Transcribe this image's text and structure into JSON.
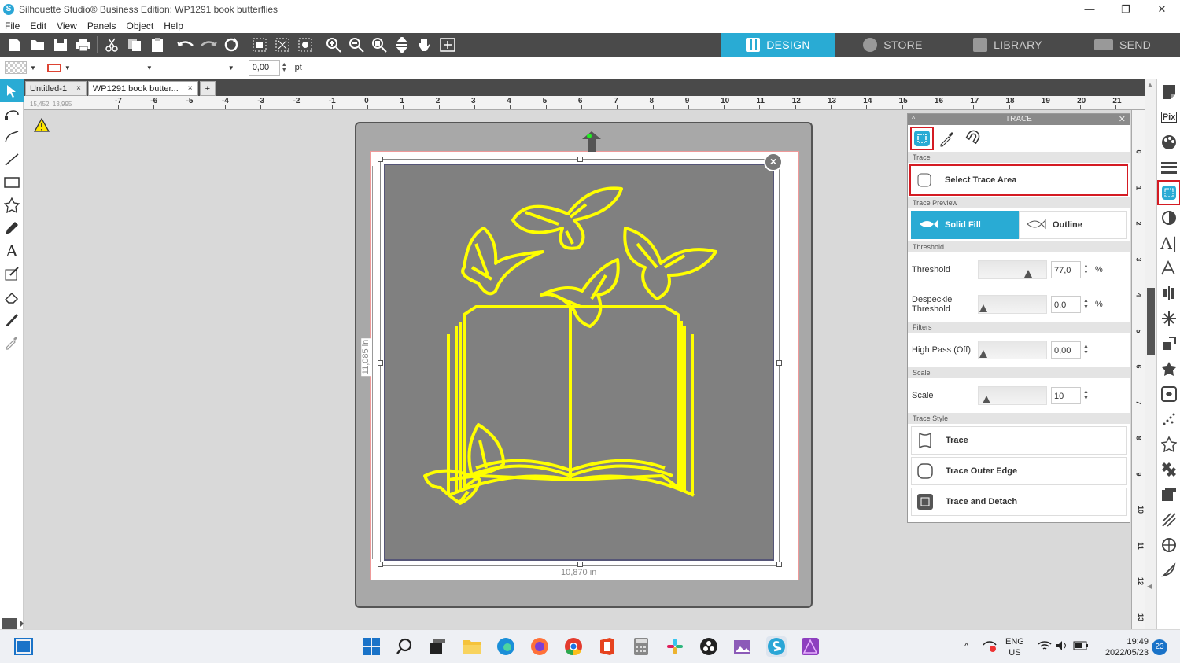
{
  "window": {
    "title": "Silhouette Studio® Business Edition: WP1291 book butterflies",
    "min_glyph": "—",
    "max_glyph": "❐",
    "close_glyph": "✕"
  },
  "menu": [
    "File",
    "Edit",
    "View",
    "Panels",
    "Object",
    "Help"
  ],
  "mode_tabs": [
    {
      "label": "DESIGN",
      "icon": "grid-icon",
      "active": true
    },
    {
      "label": "STORE",
      "icon": "silhouette-s-icon",
      "active": false
    },
    {
      "label": "LIBRARY",
      "icon": "download-box-icon",
      "active": false
    },
    {
      "label": "SEND",
      "icon": "cutter-icon",
      "active": false
    }
  ],
  "stylebar": {
    "line_width": "0,00",
    "unit": "pt"
  },
  "doc_tabs": [
    {
      "label": "Untitled-1",
      "close": "×"
    },
    {
      "label": "WP1291 book butter...",
      "close": "×"
    }
  ],
  "add_tab": "+",
  "ruler": {
    "coords": "15,452, 13,995",
    "h_labels": [
      "-7",
      "-6",
      "-5",
      "-4",
      "-3",
      "-2",
      "-1",
      "0",
      "1",
      "2",
      "3",
      "4",
      "5",
      "6",
      "7",
      "8",
      "9",
      "10",
      "11",
      "12",
      "13",
      "14",
      "15",
      "16",
      "17",
      "18",
      "19",
      "20",
      "21"
    ],
    "v_labels": [
      "0",
      "1",
      "2",
      "3",
      "4",
      "5",
      "6",
      "7",
      "8",
      "9",
      "10",
      "11",
      "12",
      "13"
    ]
  },
  "canvas": {
    "width_label": "10,870 in",
    "height_label": "11,085 in",
    "close": "×",
    "accent_yellow": "#ffff00"
  },
  "trace_panel": {
    "title": "TRACE",
    "close": "✕",
    "collapse": "^",
    "sections": {
      "trace": "Trace",
      "preview": "Trace Preview",
      "threshold": "Threshold",
      "filters": "Filters",
      "scale": "Scale",
      "style": "Trace Style"
    },
    "select_trace_area": "Select Trace Area",
    "preview_solid": "Solid Fill",
    "preview_outline": "Outline",
    "threshold": {
      "label": "Threshold",
      "value": "77,0",
      "unit": "%",
      "fraction": 0.77
    },
    "despeckle": {
      "label": "Despeckle Threshold",
      "value": "0,0",
      "unit": "%",
      "fraction": 0.0
    },
    "highpass": {
      "label": "High Pass (Off)",
      "value": "0,00",
      "fraction": 0.0
    },
    "scale": {
      "label": "Scale",
      "value": "10",
      "fraction": 0.05
    },
    "style_trace": "Trace",
    "style_outer": "Trace Outer Edge",
    "style_detach": "Trace and Detach"
  },
  "taskbar": {
    "lang_1": "ENG",
    "lang_2": "US",
    "time": "19:49",
    "date": "2022/05/23",
    "notif": "23"
  },
  "colors": {
    "accent": "#29abd4",
    "highlight_red": "#d41b23",
    "toolbar": "#4a4a4a"
  }
}
